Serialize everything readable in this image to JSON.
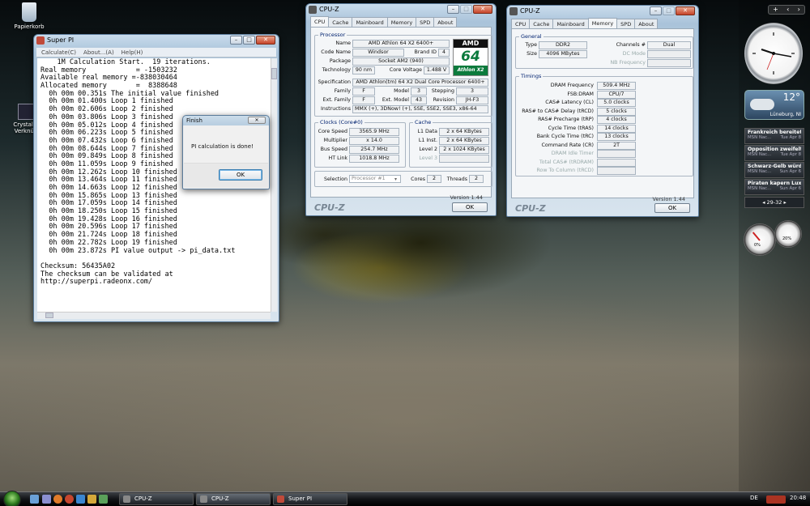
{
  "desktop": {
    "icons": [
      {
        "label": "Papierkorb"
      },
      {
        "label": "CrystalCl Verknüp"
      }
    ]
  },
  "superpi": {
    "title": "Super PI",
    "menu": [
      "Calculate(C)",
      "About...(A)",
      "Help(H)"
    ],
    "lines": [
      "    1M Calculation Start.  19 iterations.",
      "Real memory            = -1503232",
      "Available real memory =-838030464",
      "Allocated memory       =  8388648",
      "  0h 00m 00.351s The initial value finished",
      "  0h 00m 01.400s Loop 1 finished",
      "  0h 00m 02.606s Loop 2 finished",
      "  0h 00m 03.806s Loop 3 finished",
      "  0h 00m 05.012s Loop 4 finished",
      "  0h 00m 06.223s Loop 5 finished",
      "  0h 00m 07.432s Loop 6 finished",
      "  0h 00m 08.644s Loop 7 finished",
      "  0h 00m 09.849s Loop 8 finished",
      "  0h 00m 11.059s Loop 9 finished",
      "  0h 00m 12.262s Loop 10 finished",
      "  0h 00m 13.464s Loop 11 finished",
      "  0h 00m 14.663s Loop 12 finished",
      "  0h 00m 15.865s Loop 13 finished",
      "  0h 00m 17.059s Loop 14 finished",
      "  0h 00m 18.250s Loop 15 finished",
      "  0h 00m 19.428s Loop 16 finished",
      "  0h 00m 20.596s Loop 17 finished",
      "  0h 00m 21.724s Loop 18 finished",
      "  0h 00m 22.782s Loop 19 finished",
      "  0h 00m 23.872s PI value output -> pi_data.txt",
      "",
      "Checksum: 56435A02",
      "The checksum can be validated at",
      "http://superpi.radeonx.com/"
    ]
  },
  "finish": {
    "title": "Finish",
    "message": "PI calculation is done!",
    "ok": "OK"
  },
  "cpuz1": {
    "title": "CPU-Z",
    "tabs": [
      "CPU",
      "Cache",
      "Mainboard",
      "Memory",
      "SPD",
      "About"
    ],
    "active_tab": "CPU",
    "processor": {
      "group": "Processor",
      "name_label": "Name",
      "name": "AMD Athlon 64 X2 6400+",
      "codename_label": "Code Name",
      "codename": "Windsor",
      "brandid_label": "Brand ID",
      "brandid": "4",
      "package_label": "Package",
      "package": "Socket AM2 (940)",
      "tech_label": "Technology",
      "tech": "90 nm",
      "voltage_label": "Core Voltage",
      "voltage": "1.488 V",
      "spec_label": "Specification",
      "spec": "AMD Athlon(tm) 64 X2 Dual Core Processor 6400+",
      "family_label": "Family",
      "family": "F",
      "model_label": "Model",
      "model": "3",
      "stepping_label": "Stepping",
      "stepping": "3",
      "extfamily_label": "Ext. Family",
      "extfamily": "F",
      "extmodel_label": "Ext. Model",
      "extmodel": "43",
      "revision_label": "Revision",
      "revision": "JH-F3",
      "instr_label": "Instructions",
      "instr": "MMX (+), 3DNow! (+), SSE, SSE2, SSE3, x86-64",
      "logo_top": "AMD",
      "logo_mid": "64",
      "logo_bottom": "Athlon X2"
    },
    "clocks": {
      "group": "Clocks (Core#0)",
      "corespeed_label": "Core Speed",
      "corespeed": "3565.9 MHz",
      "mult_label": "Multiplier",
      "mult": "x 14.0",
      "bus_label": "Bus Speed",
      "bus": "254.7 MHz",
      "ht_label": "HT Link",
      "ht": "1018.8 MHz"
    },
    "cache": {
      "group": "Cache",
      "l1d_label": "L1 Data",
      "l1d": "2 x 64 KBytes",
      "l1i_label": "L1 Inst.",
      "l1i": "2 x 64 KBytes",
      "l2_label": "Level 2",
      "l2": "2 x 1024 KBytes",
      "l3_label": "Level 3",
      "l3": ""
    },
    "selection_label": "Selection",
    "selection": "Processor #1",
    "cores_label": "Cores",
    "cores": "2",
    "threads_label": "Threads",
    "threads": "2",
    "version": "Version 1.44",
    "ok": "OK",
    "brand": "CPU-Z"
  },
  "cpuz2": {
    "title": "CPU-Z",
    "tabs": [
      "CPU",
      "Cache",
      "Mainboard",
      "Memory",
      "SPD",
      "About"
    ],
    "active_tab": "Memory",
    "general": {
      "group": "General",
      "type_label": "Type",
      "type": "DDR2",
      "size_label": "Size",
      "size": "4096 MBytes",
      "channels_label": "Channels #",
      "channels": "Dual",
      "dcmode_label": "DC Mode",
      "dcmode": "",
      "nbfreq_label": "NB Frequency",
      "nbfreq": ""
    },
    "timings": {
      "group": "Timings",
      "rows": [
        {
          "label": "DRAM Frequency",
          "value": "509.4 MHz",
          "dim": false
        },
        {
          "label": "FSB:DRAM",
          "value": "CPU/7",
          "dim": false
        },
        {
          "label": "CAS# Latency (CL)",
          "value": "5.0 clocks",
          "dim": false
        },
        {
          "label": "RAS# to CAS# Delay (tRCD)",
          "value": "5 clocks",
          "dim": false
        },
        {
          "label": "RAS# Precharge (tRP)",
          "value": "4 clocks",
          "dim": false
        },
        {
          "label": "Cycle Time (tRAS)",
          "value": "14 clocks",
          "dim": false
        },
        {
          "label": "Bank Cycle Time (tRC)",
          "value": "13 clocks",
          "dim": false
        },
        {
          "label": "Command Rate (CR)",
          "value": "2T",
          "dim": false
        },
        {
          "label": "DRAM Idle Timer",
          "value": "",
          "dim": true
        },
        {
          "label": "Total CAS# (tRDRAM)",
          "value": "",
          "dim": true
        },
        {
          "label": "Row To Column (tRCD)",
          "value": "",
          "dim": true
        }
      ]
    },
    "version": "Version 1.44",
    "ok": "OK",
    "brand": "CPU-Z"
  },
  "sidebar": {
    "weather_temp": "12°",
    "weather_city": "Lüneburg, NI",
    "news": [
      {
        "title": "Frankreich bereitet B...",
        "source": "MSN Nac...",
        "date": "Tue Apr 8"
      },
      {
        "title": "Opposition zweifelt ...",
        "source": "MSN Nac...",
        "date": "Tue Apr 8"
      },
      {
        "title": "Schwarz-Gelb würde...",
        "source": "MSN Nac...",
        "date": "Sun Apr 6"
      },
      {
        "title": "Piraten kapern Luxus...",
        "source": "MSN Nac...",
        "date": "Sun Apr 6"
      }
    ],
    "pager": "29-32",
    "meter_cpu": "0%",
    "meter_mem": "20%"
  },
  "taskbar": {
    "buttons": [
      {
        "label": "CPU-Z",
        "active": false
      },
      {
        "label": "CPU-Z",
        "active": true
      },
      {
        "label": "Super PI",
        "active": false
      }
    ],
    "lang": "DE",
    "time": "20:48"
  },
  "colors": {
    "amd_green": "#0b7a3c",
    "title_bar": "#aac3da",
    "close_red": "#c7442a"
  }
}
